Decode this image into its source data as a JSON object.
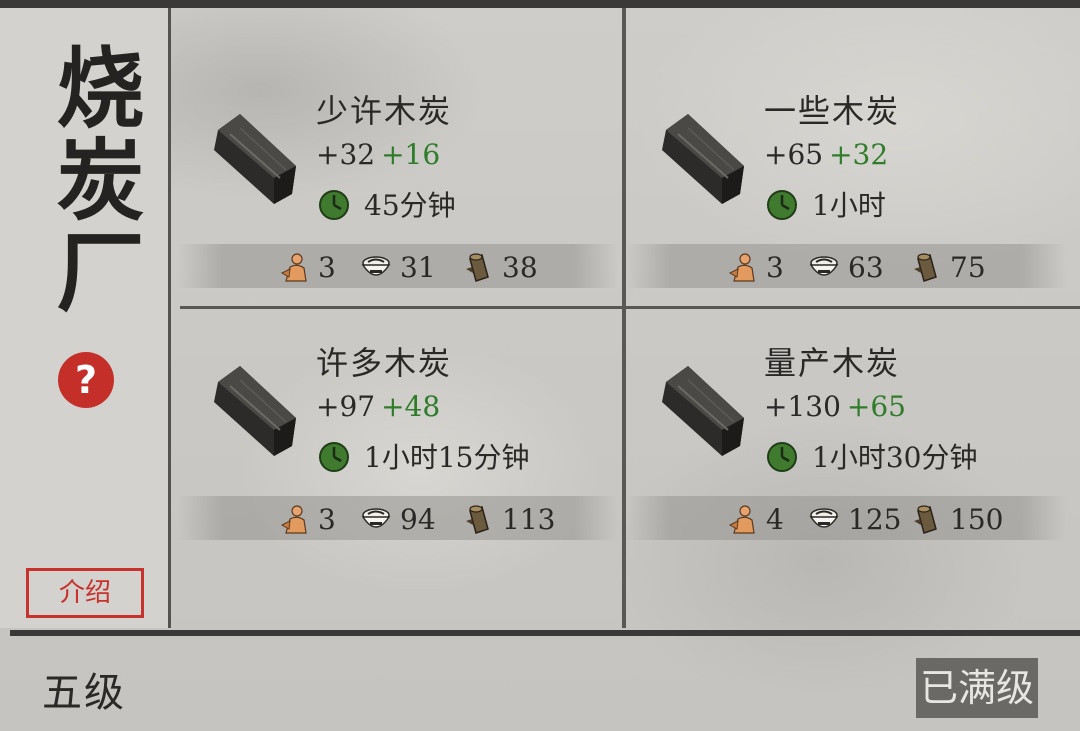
{
  "sidebar": {
    "title": "烧炭厂",
    "help_label": "?",
    "intro_label": "介绍"
  },
  "recipes": [
    {
      "name": "少许木炭",
      "amount": "+32",
      "bonus": "+16",
      "time": "45分钟",
      "workers": "3",
      "food": "31",
      "wood": "38"
    },
    {
      "name": "一些木炭",
      "amount": "+65",
      "bonus": "+32",
      "time": "1小时",
      "workers": "3",
      "food": "63",
      "wood": "75"
    },
    {
      "name": "许多木炭",
      "amount": "+97",
      "bonus": "+48",
      "time": "1小时15分钟",
      "workers": "3",
      "food": "94",
      "wood": "113"
    },
    {
      "name": "量产木炭",
      "amount": "+130",
      "bonus": "+65",
      "time": "1小时30分钟",
      "workers": "4",
      "food": "125",
      "wood": "150"
    }
  ],
  "footer": {
    "level": "五级",
    "max_label": "已满级"
  },
  "colors": {
    "bonus": "#2f7c2a",
    "accent_red": "#c8322c"
  },
  "icons": [
    "charcoal-log-icon",
    "clock-icon",
    "worker-icon",
    "food-bowl-icon",
    "wood-log-icon"
  ]
}
